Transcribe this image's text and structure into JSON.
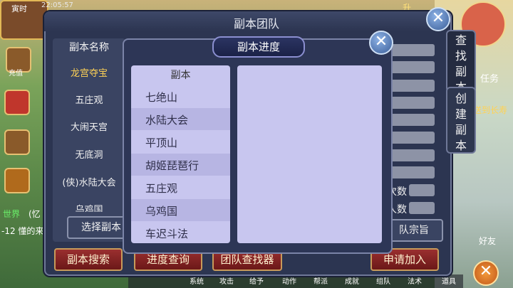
{
  "hud": {
    "time_label": "寅时",
    "clock": "22:05:57",
    "recharge": "充值",
    "world_tag": "世界",
    "chat_line1": "(忆",
    "chat_line2": "-12  懂的来",
    "task_label": "任务",
    "task_hint": "送到长寿",
    "friend_label": "好友",
    "bottom_menu": [
      "系统",
      "攻击",
      "给予",
      "动作",
      "帮派",
      "成就",
      "组队",
      "法术",
      "道具"
    ],
    "top_right_tag": "升"
  },
  "team_dialog": {
    "title": "副本团队",
    "list_header": "副本名称",
    "list_items": [
      "龙宫夺宝",
      "五庄观",
      "大闹天宫",
      "无底洞",
      "(侠)水陆大会",
      "乌鸡国"
    ],
    "select_button": "选择副本",
    "right_labels": [
      "次数",
      "人数"
    ],
    "sect_button": "队宗旨",
    "tabs": [
      "查找副本",
      "创建副本"
    ],
    "bottom_buttons": {
      "search": "副本搜索",
      "progress": "进度查询",
      "finder": "团队查找器",
      "apply": "申请加入"
    }
  },
  "progress_dialog": {
    "title": "副本进度",
    "list_header": "副本",
    "items": [
      "七绝山",
      "水陆大会",
      "平顶山",
      "胡姬琵琶行",
      "五庄观",
      "乌鸡国",
      "车迟斗法"
    ]
  },
  "colors": {
    "selected_text": "#ffd255",
    "list_bg": "#c8c6ef",
    "list_alt": "#b7b5e3",
    "dialog_bg": "#2c3551"
  }
}
